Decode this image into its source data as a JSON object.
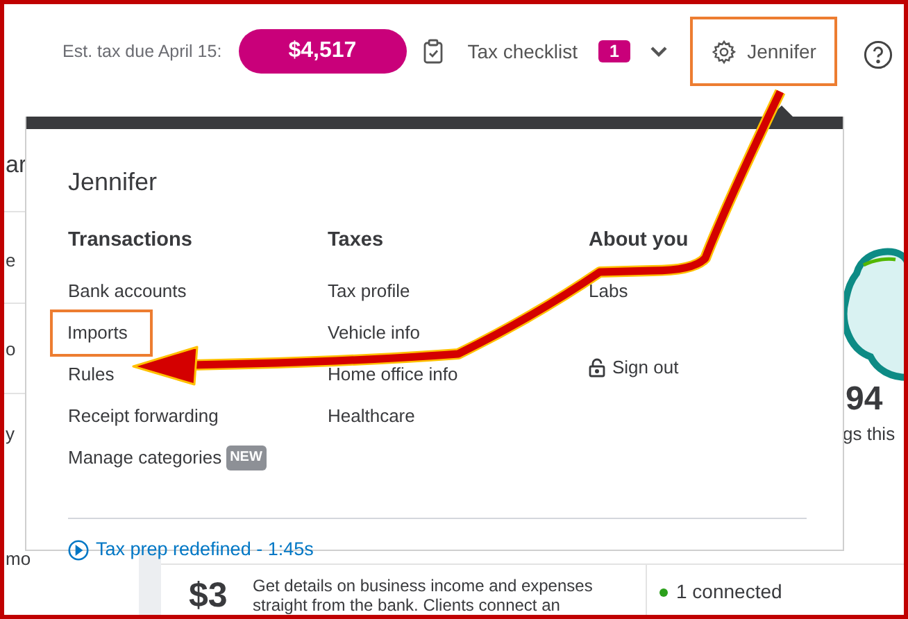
{
  "header": {
    "tax_due_label": "Est. tax due April 15:",
    "tax_due_amount": "$4,517",
    "checklist_label": "Tax checklist",
    "checklist_count": "1",
    "user_name": "Jennifer",
    "user_highlighted": true
  },
  "background": {
    "left_fragments": [
      "ar",
      "e",
      "o",
      "y",
      "mo"
    ],
    "stat_value": "94",
    "stat_caption": "gs this",
    "card_amount": "$3",
    "card_text": "Get details on business income and expenses straight from the bank. Clients connect an",
    "connection_status": "1 connected"
  },
  "menu": {
    "title": "Jennifer",
    "columns": [
      {
        "heading": "Transactions",
        "items": [
          {
            "kind": "link",
            "label": "Bank accounts",
            "highlighted": false
          },
          {
            "kind": "link",
            "label": "Imports",
            "highlighted": true
          },
          {
            "kind": "link",
            "label": "Rules",
            "highlighted": false
          },
          {
            "kind": "link",
            "label": "Receipt forwarding",
            "highlighted": false
          },
          {
            "kind": "link",
            "label": "Manage categories",
            "badge": "NEW",
            "highlighted": false
          }
        ]
      },
      {
        "heading": "Taxes",
        "items": [
          {
            "kind": "link",
            "label": "Tax profile",
            "highlighted": false
          },
          {
            "kind": "link",
            "label": "Vehicle info",
            "highlighted": false
          },
          {
            "kind": "link",
            "label": "Home office info",
            "highlighted": false
          },
          {
            "kind": "link",
            "label": "Healthcare",
            "highlighted": false
          }
        ]
      },
      {
        "heading": "About you",
        "items": [
          {
            "kind": "link",
            "label": "Labs",
            "highlighted": false
          },
          {
            "kind": "signout",
            "label": "Sign out",
            "highlighted": false
          }
        ]
      }
    ],
    "footer_link": "Tax prep redefined - 1:45s"
  }
}
